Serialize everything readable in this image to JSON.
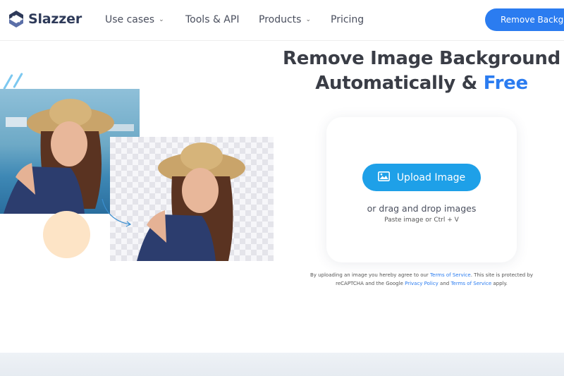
{
  "brand": {
    "name": "Slazzer",
    "logo_icon": "slazzer-logo-icon"
  },
  "nav": {
    "items": [
      {
        "label": "Use cases",
        "has_dropdown": true
      },
      {
        "label": "Tools & API",
        "has_dropdown": false
      },
      {
        "label": "Products",
        "has_dropdown": true
      },
      {
        "label": "Pricing",
        "has_dropdown": false
      }
    ],
    "cta_label": "Remove Background"
  },
  "hero": {
    "title_line1": "Remove Image Background",
    "title_line2_prefix": "Automatically & ",
    "title_line2_highlight": "Free"
  },
  "upload": {
    "button_label": "Upload Image",
    "button_icon": "image-icon",
    "drag_text": "or drag and drop images",
    "paste_text": "Paste image or Ctrl + V"
  },
  "terms": {
    "part1": "By uploading an image you hereby agree to our ",
    "link_terms": "Terms of Service",
    "part2": ". This site is protected by reCAPTCHA and the Google ",
    "link_privacy": "Privacy Policy",
    "part3": " and ",
    "link_terms2": "Terms of Service",
    "part4": " apply."
  },
  "colors": {
    "accent": "#2b7cf0",
    "upload_button": "#1ea0e8",
    "title": "#3a3d46",
    "peach": "#fde4c6"
  }
}
